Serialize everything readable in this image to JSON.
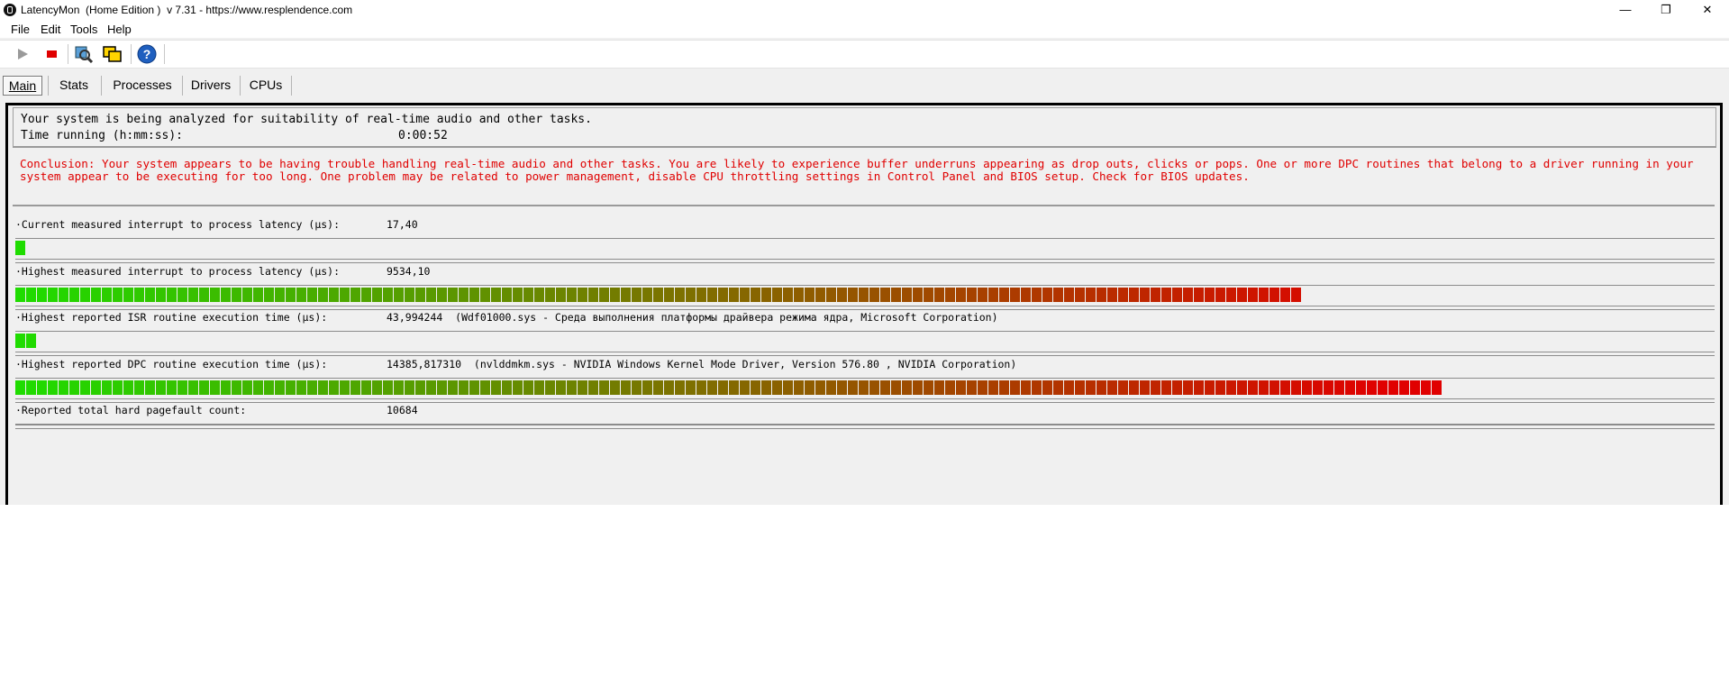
{
  "window": {
    "title": "LatencyMon  (Home Edition )  v 7.31 - https://www.resplendence.com",
    "controls": {
      "minimize": "—",
      "maximize": "❐",
      "close": "✕"
    }
  },
  "menu": [
    {
      "label": "File"
    },
    {
      "label": "Edit"
    },
    {
      "label": "Tools"
    },
    {
      "label": "Help"
    }
  ],
  "toolbar": {
    "buttons": [
      "play-icon",
      "stop-icon",
      "search-drivers-icon",
      "windows-icon",
      "help-icon"
    ],
    "help_glyph": "?"
  },
  "tabs": [
    {
      "label": "Main",
      "active": true
    },
    {
      "label": "Stats"
    },
    {
      "label": "Processes"
    },
    {
      "label": "Drivers"
    },
    {
      "label": "CPUs"
    }
  ],
  "status": {
    "analyzing": "Your system is being analyzed for suitability of real-time audio and other tasks.",
    "time_label": "Time running (h:mm:ss):",
    "time_value": "0:00:52"
  },
  "conclusion": "Conclusion: Your system appears to be having trouble handling real-time audio and other tasks. You are likely to experience buffer underruns appearing as drop outs, clicks or pops. One or more DPC routines that belong to a driver running in your system appear to be executing for too long. One problem may be related to power management, disable CPU throttling settings in Control Panel and BIOS setup. Check for BIOS updates.",
  "metrics": [
    {
      "label": "·Current measured interrupt to process latency (µs):",
      "value": "17,40",
      "bar_fraction": 0.006,
      "has_bar": true
    },
    {
      "label": "·Highest measured interrupt to process latency (µs):",
      "value": "9534,10",
      "bar_fraction": 0.757,
      "has_bar": true
    },
    {
      "label": "·Highest reported ISR routine execution time (µs):",
      "value": "43,994244  (Wdf01000.sys - Среда выполнения платформы драйвера режима ядра, Microsoft Corporation)",
      "bar_fraction": 0.012,
      "has_bar": true
    },
    {
      "label": "·Highest reported DPC routine execution time (µs):",
      "value": "14385,817310  (nvlddmkm.sys - NVIDIA Windows Kernel Mode Driver, Version 576.80 , NVIDIA Corporation)",
      "bar_fraction": 0.84,
      "has_bar": true
    },
    {
      "label": "·Reported total hard pagefault count:",
      "value": "10684",
      "bar_fraction": 0,
      "has_bar": true
    }
  ],
  "colors": {
    "conclusion_text": "#e00000",
    "bar_green": "#1fdc00",
    "bar_red": "#e00000",
    "stop_red": "#e00000",
    "help_blue": "#1f5fbf"
  }
}
